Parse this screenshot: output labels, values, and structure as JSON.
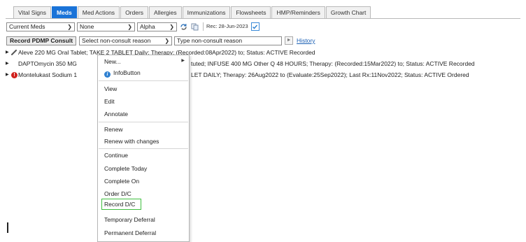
{
  "tabs": [
    "Vital Signs",
    "Meds",
    "Med Actions",
    "Orders",
    "Allergies",
    "Immunizations",
    "Flowsheets",
    "HMP/Reminders",
    "Growth Chart"
  ],
  "active_tab": "Meds",
  "filters": {
    "med_filter": "Current Meds",
    "second_filter": "None",
    "sort": "Alpha",
    "rec_date": "Rec: 28-Jun-2023"
  },
  "consult": {
    "button": "Record PDMP Consult",
    "reason_select": "Select non-consult reason",
    "reason_input_placeholder": "Type non-consult reason",
    "history_link": "History"
  },
  "meds": [
    {
      "text": "Aleve 220 MG Oral Tablet; TAKE 2 TABLET Daily; Therapy: (Recorded:08Apr2022) to; Status: ACTIVE Recorded"
    },
    {
      "text": "DAPTOmycin 350 MG Intravenous Solution Reconstituted; INFUSE 400 MG Other Q 48 HOURS; Therapy: (Recorded:15Mar2022) to; Status: ACTIVE Recorded"
    },
    {
      "text": "Montelukast Sodium 10 MG Oral Tablet; TAKE 1 TABLET DAILY; Therapy: 26Aug2022 to (Evaluate:25Sep2022); Last Rx:11Nov2022; Status: ACTIVE Ordered"
    }
  ],
  "med_visible": [
    "Aleve 220 MG Oral Tablet; TAKE 2 TABLET Daily; Therapy: (Recorded:08Apr2022) to; Status: ACTIVE Recorded",
    "DAPTOmycin 350 MG",
    "tuted; INFUSE 400 MG Other Q 48 HOURS; Therapy: (Recorded:15Mar2022) to; Status: ACTIVE Recorded",
    "Montelukast Sodium 1",
    "LET DAILY; Therapy: 26Aug2022 to (Evaluate:25Sep2022); Last Rx:11Nov2022; Status: ACTIVE Ordered"
  ],
  "context_menu": {
    "new": "New...",
    "infobutton": "InfoButton",
    "items_group1": [
      "View",
      "Edit",
      "Annotate"
    ],
    "items_group2": [
      "Renew",
      "Renew with changes"
    ],
    "items_group3": [
      "Continue",
      "Complete Today",
      "Complete On",
      "Order D/C",
      "Record D/C",
      "Temporary Deferral",
      "Permanent Deferral"
    ],
    "highlighted": "Record D/C"
  },
  "colors": {
    "active_tab": "#1a73d8",
    "alert": "#d0201c",
    "highlight": "#3fbf3f",
    "link": "#1a5fb4"
  },
  "icons": [
    "chevron-down-icon",
    "refresh-icon",
    "copy-icon",
    "calendar-check-icon",
    "right-arrow-icon",
    "pill-icon",
    "alert-icon",
    "info-icon",
    "submenu-arrow-icon"
  ]
}
